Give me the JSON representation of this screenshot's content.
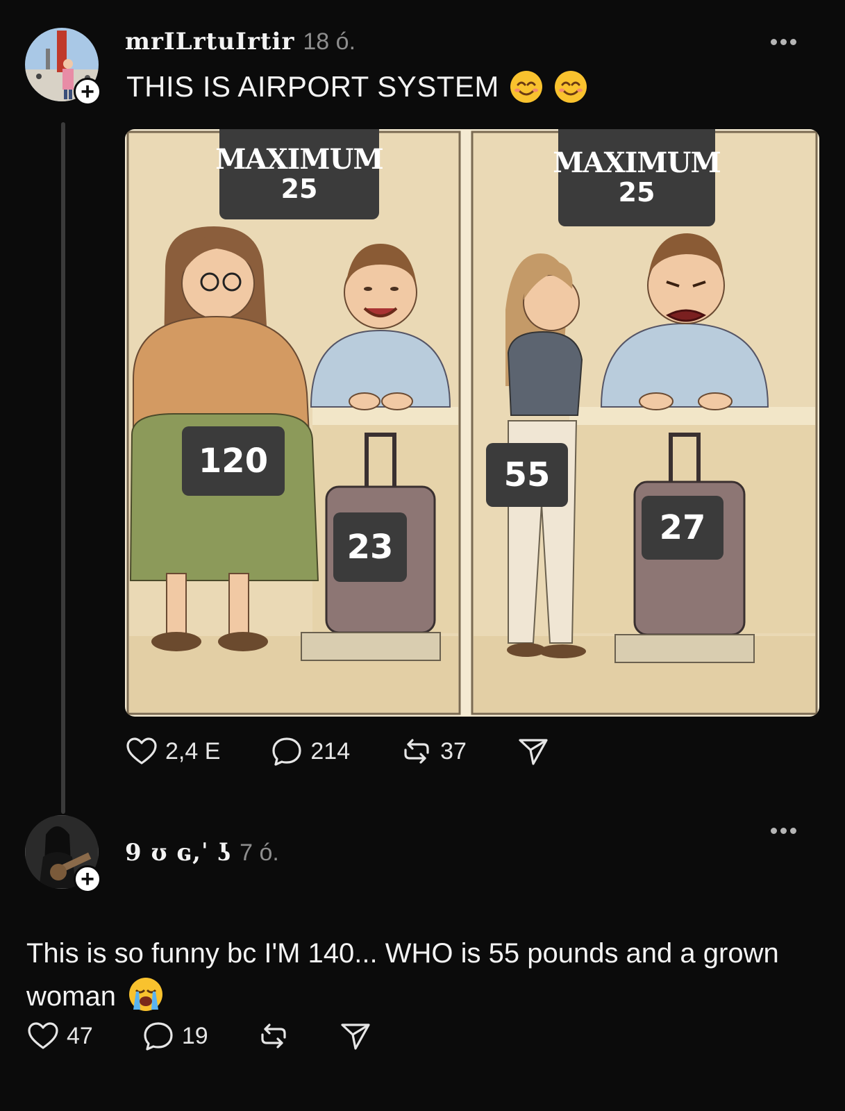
{
  "post": {
    "username": "mrILrtuIrtir",
    "time": "18 ó.",
    "text": "THIS IS AIRPORT SYSTEM",
    "emoji": "smiling-face-emoji",
    "image": {
      "left_panel": {
        "sign_title": "MAXIMUM",
        "sign_value": "25",
        "person_weight": "120",
        "luggage_weight": "23"
      },
      "right_panel": {
        "sign_title": "MAXIMUM",
        "sign_value": "25",
        "person_weight": "55",
        "luggage_weight": "27"
      }
    },
    "actions": {
      "likes": "2,4 E",
      "comments": "214",
      "reposts": "37"
    }
  },
  "reply": {
    "username": "9 ʊ ɢ,ˈ ʖ",
    "time": "7 ó.",
    "text": "This is so funny bc I'M 140... WHO is 55 pounds and a grown woman",
    "emoji": "loudly-crying-face-emoji",
    "actions": {
      "likes": "47",
      "comments": "19"
    }
  },
  "colors": {
    "background": "#0b0b0b",
    "text": "#f3f3f3",
    "muted": "#8d8d8d",
    "comic_bg": "#f4ead2"
  }
}
